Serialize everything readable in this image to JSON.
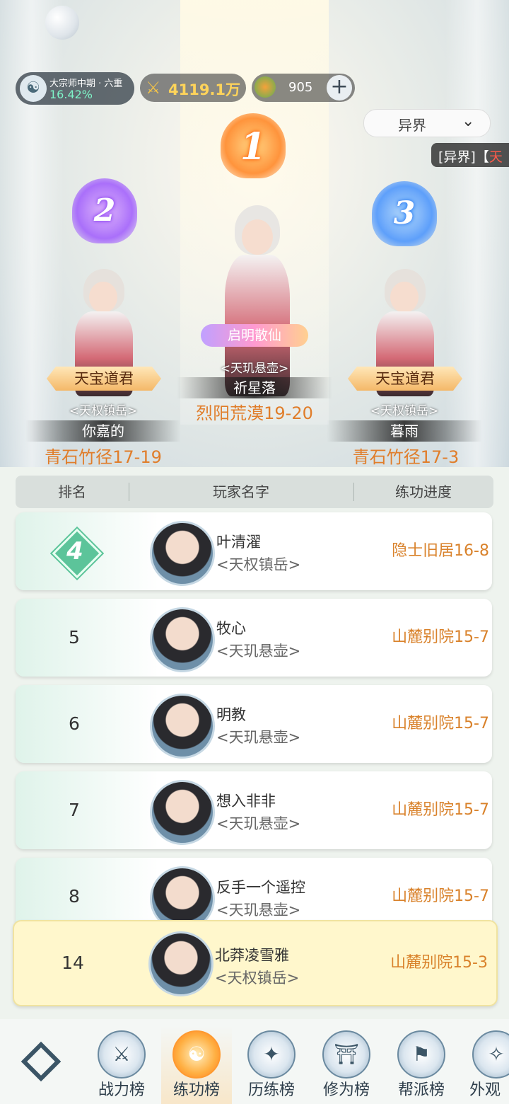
{
  "top": {
    "rank_title": "大宗师中期 · 六重",
    "rank_pct": "16.42%",
    "power": "4119.1万",
    "coins": "905",
    "plus": "+",
    "dropdown_label": "异界",
    "notice_prefix": "[异界]【",
    "notice_red": "天"
  },
  "podium": [
    {
      "badge": "1",
      "title": "启明散仙",
      "sect": "<天玑悬壶>",
      "name": "祈星落",
      "progress": "烈阳荒漠19-20"
    },
    {
      "badge": "2",
      "title": "天宝道君",
      "sect": "<天权镇岳>",
      "name": "你嘉的",
      "progress": "青石竹径17-19"
    },
    {
      "badge": "3",
      "title": "天宝道君",
      "sect": "<天权镇岳>",
      "name": "暮雨",
      "progress": "青石竹径17-3"
    }
  ],
  "table": {
    "headers": [
      "排名",
      "玩家名字",
      "练功进度"
    ],
    "rows": [
      {
        "rank": "4",
        "name": "叶清濯",
        "sect": "<天权镇岳>",
        "progress": "隐士旧居16-8"
      },
      {
        "rank": "5",
        "name": "牧心",
        "sect": "<天玑悬壶>",
        "progress": "山麓别院15-7"
      },
      {
        "rank": "6",
        "name": "明教",
        "sect": "<天玑悬壶>",
        "progress": "山麓别院15-7"
      },
      {
        "rank": "7",
        "name": "想入非非",
        "sect": "<天玑悬壶>",
        "progress": "山麓别院15-7"
      },
      {
        "rank": "8",
        "name": "反手一个遥控",
        "sect": "<天玑悬壶>",
        "progress": "山麓别院15-7"
      }
    ],
    "self": {
      "rank": "14",
      "name": "北莽凌雪雅",
      "sect": "<天权镇岳>",
      "progress": "山麓别院15-3"
    }
  },
  "nav": [
    {
      "label": "战力榜",
      "icon": "swords-icon"
    },
    {
      "label": "练功榜",
      "icon": "yin-yang-icon",
      "active": true
    },
    {
      "label": "历练榜",
      "icon": "compass-star-icon"
    },
    {
      "label": "修为榜",
      "icon": "hat-icon"
    },
    {
      "label": "帮派榜",
      "icon": "banner-icon"
    },
    {
      "label": "外观",
      "icon": "costume-icon"
    }
  ]
}
